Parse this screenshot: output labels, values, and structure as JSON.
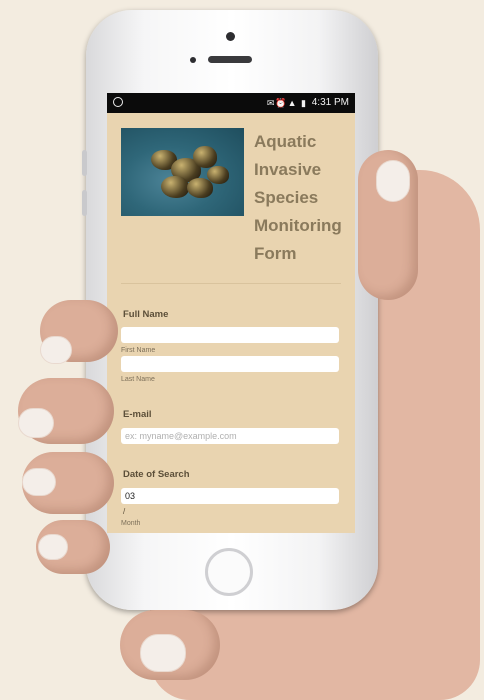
{
  "status_bar": {
    "time": "4:31 PM",
    "icons": "✉⏰▲ ▮"
  },
  "form": {
    "title_lines": [
      "Aquatic",
      "Invasive",
      "Species",
      "Monitoring",
      "Form"
    ],
    "full_name": {
      "label": "Full Name",
      "first": {
        "value": "",
        "sublabel": "First Name"
      },
      "last": {
        "value": "",
        "sublabel": "Last Name"
      }
    },
    "email": {
      "label": "E-mail",
      "placeholder": "ex: myname@example.com",
      "value": ""
    },
    "date": {
      "label": "Date of Search",
      "month_value": "03",
      "separator": "/",
      "month_sublabel": "Month"
    }
  },
  "colors": {
    "form_background": "#e9d4b0",
    "title": "#8a7a5c",
    "label": "#5c4f39"
  }
}
